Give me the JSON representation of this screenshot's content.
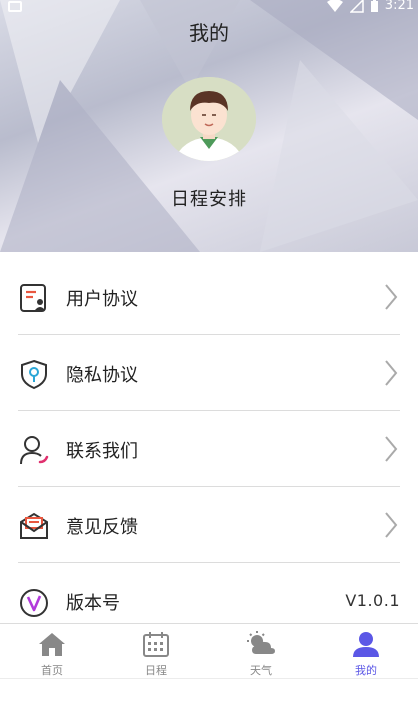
{
  "status_bar": {
    "time": "3:21"
  },
  "header": {
    "title": "我的"
  },
  "profile": {
    "name": "日程安排"
  },
  "menu": {
    "items": [
      {
        "label": "用户协议",
        "icon": "user-agreement-icon"
      },
      {
        "label": "隐私协议",
        "icon": "privacy-shield-icon"
      },
      {
        "label": "联系我们",
        "icon": "contact-person-icon"
      },
      {
        "label": "意见反馈",
        "icon": "feedback-mail-icon"
      },
      {
        "label": "版本号",
        "icon": "version-v-icon",
        "value": "V1.0.1"
      }
    ]
  },
  "tabbar": {
    "tabs": [
      {
        "label": "首页",
        "icon": "home-icon",
        "active": false
      },
      {
        "label": "日程",
        "icon": "calendar-icon",
        "active": false
      },
      {
        "label": "天气",
        "icon": "weather-icon",
        "active": false
      },
      {
        "label": "我的",
        "icon": "profile-icon",
        "active": true
      }
    ]
  },
  "colors": {
    "accent": "#5b57e6",
    "divider": "#dcdcdc",
    "icon_red": "#e8573f"
  }
}
